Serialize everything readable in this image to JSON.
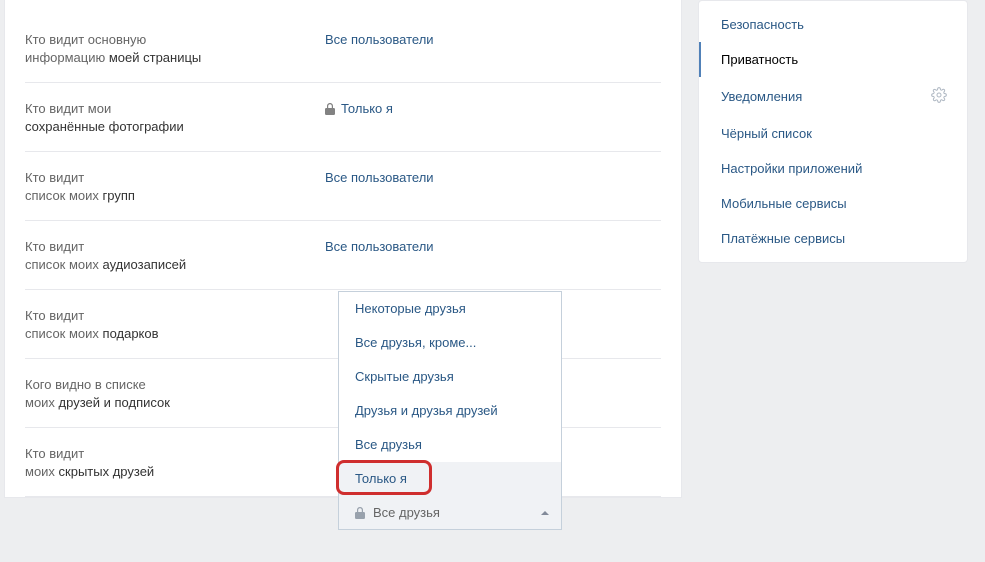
{
  "settings": {
    "rows": [
      {
        "label_pre": "Кто видит основную",
        "label_post_plain": "информацию ",
        "label_bold": "моей страницы",
        "value": "Все пользователи",
        "locked": false
      },
      {
        "label_pre": "Кто видит мои",
        "label_post_plain": "",
        "label_bold": "сохранённые фотографии",
        "value": "Только я",
        "locked": true
      },
      {
        "label_pre": "Кто видит",
        "label_post_plain": "список моих ",
        "label_bold": "групп",
        "value": "Все пользователи",
        "locked": false
      },
      {
        "label_pre": "Кто видит",
        "label_post_plain": "список моих ",
        "label_bold": "аудиозаписей",
        "value": "Все пользователи",
        "locked": false
      },
      {
        "label_pre": "Кто видит",
        "label_post_plain": "список моих ",
        "label_bold": "подарков",
        "value": "",
        "locked": false
      },
      {
        "label_pre": "Кого видно в списке",
        "label_post_plain": "моих ",
        "label_bold": "друзей и подписок",
        "value": "",
        "locked": false
      },
      {
        "label_pre": "Кто видит",
        "label_post_plain": "моих ",
        "label_bold": "скрытых друзей",
        "value": "",
        "locked": false
      }
    ]
  },
  "dropdown": {
    "options": [
      "Некоторые друзья",
      "Все друзья, кроме...",
      "Скрытые друзья",
      "Друзья и друзья друзей",
      "Все друзья",
      "Только я"
    ],
    "selected": "Все друзья"
  },
  "sidebar": {
    "items": [
      {
        "label": "Безопасность"
      },
      {
        "label": "Приватность"
      },
      {
        "label": "Уведомления"
      },
      {
        "label": "Чёрный список"
      },
      {
        "label": "Настройки приложений"
      },
      {
        "label": "Мобильные сервисы"
      },
      {
        "label": "Платёжные сервисы"
      }
    ]
  }
}
